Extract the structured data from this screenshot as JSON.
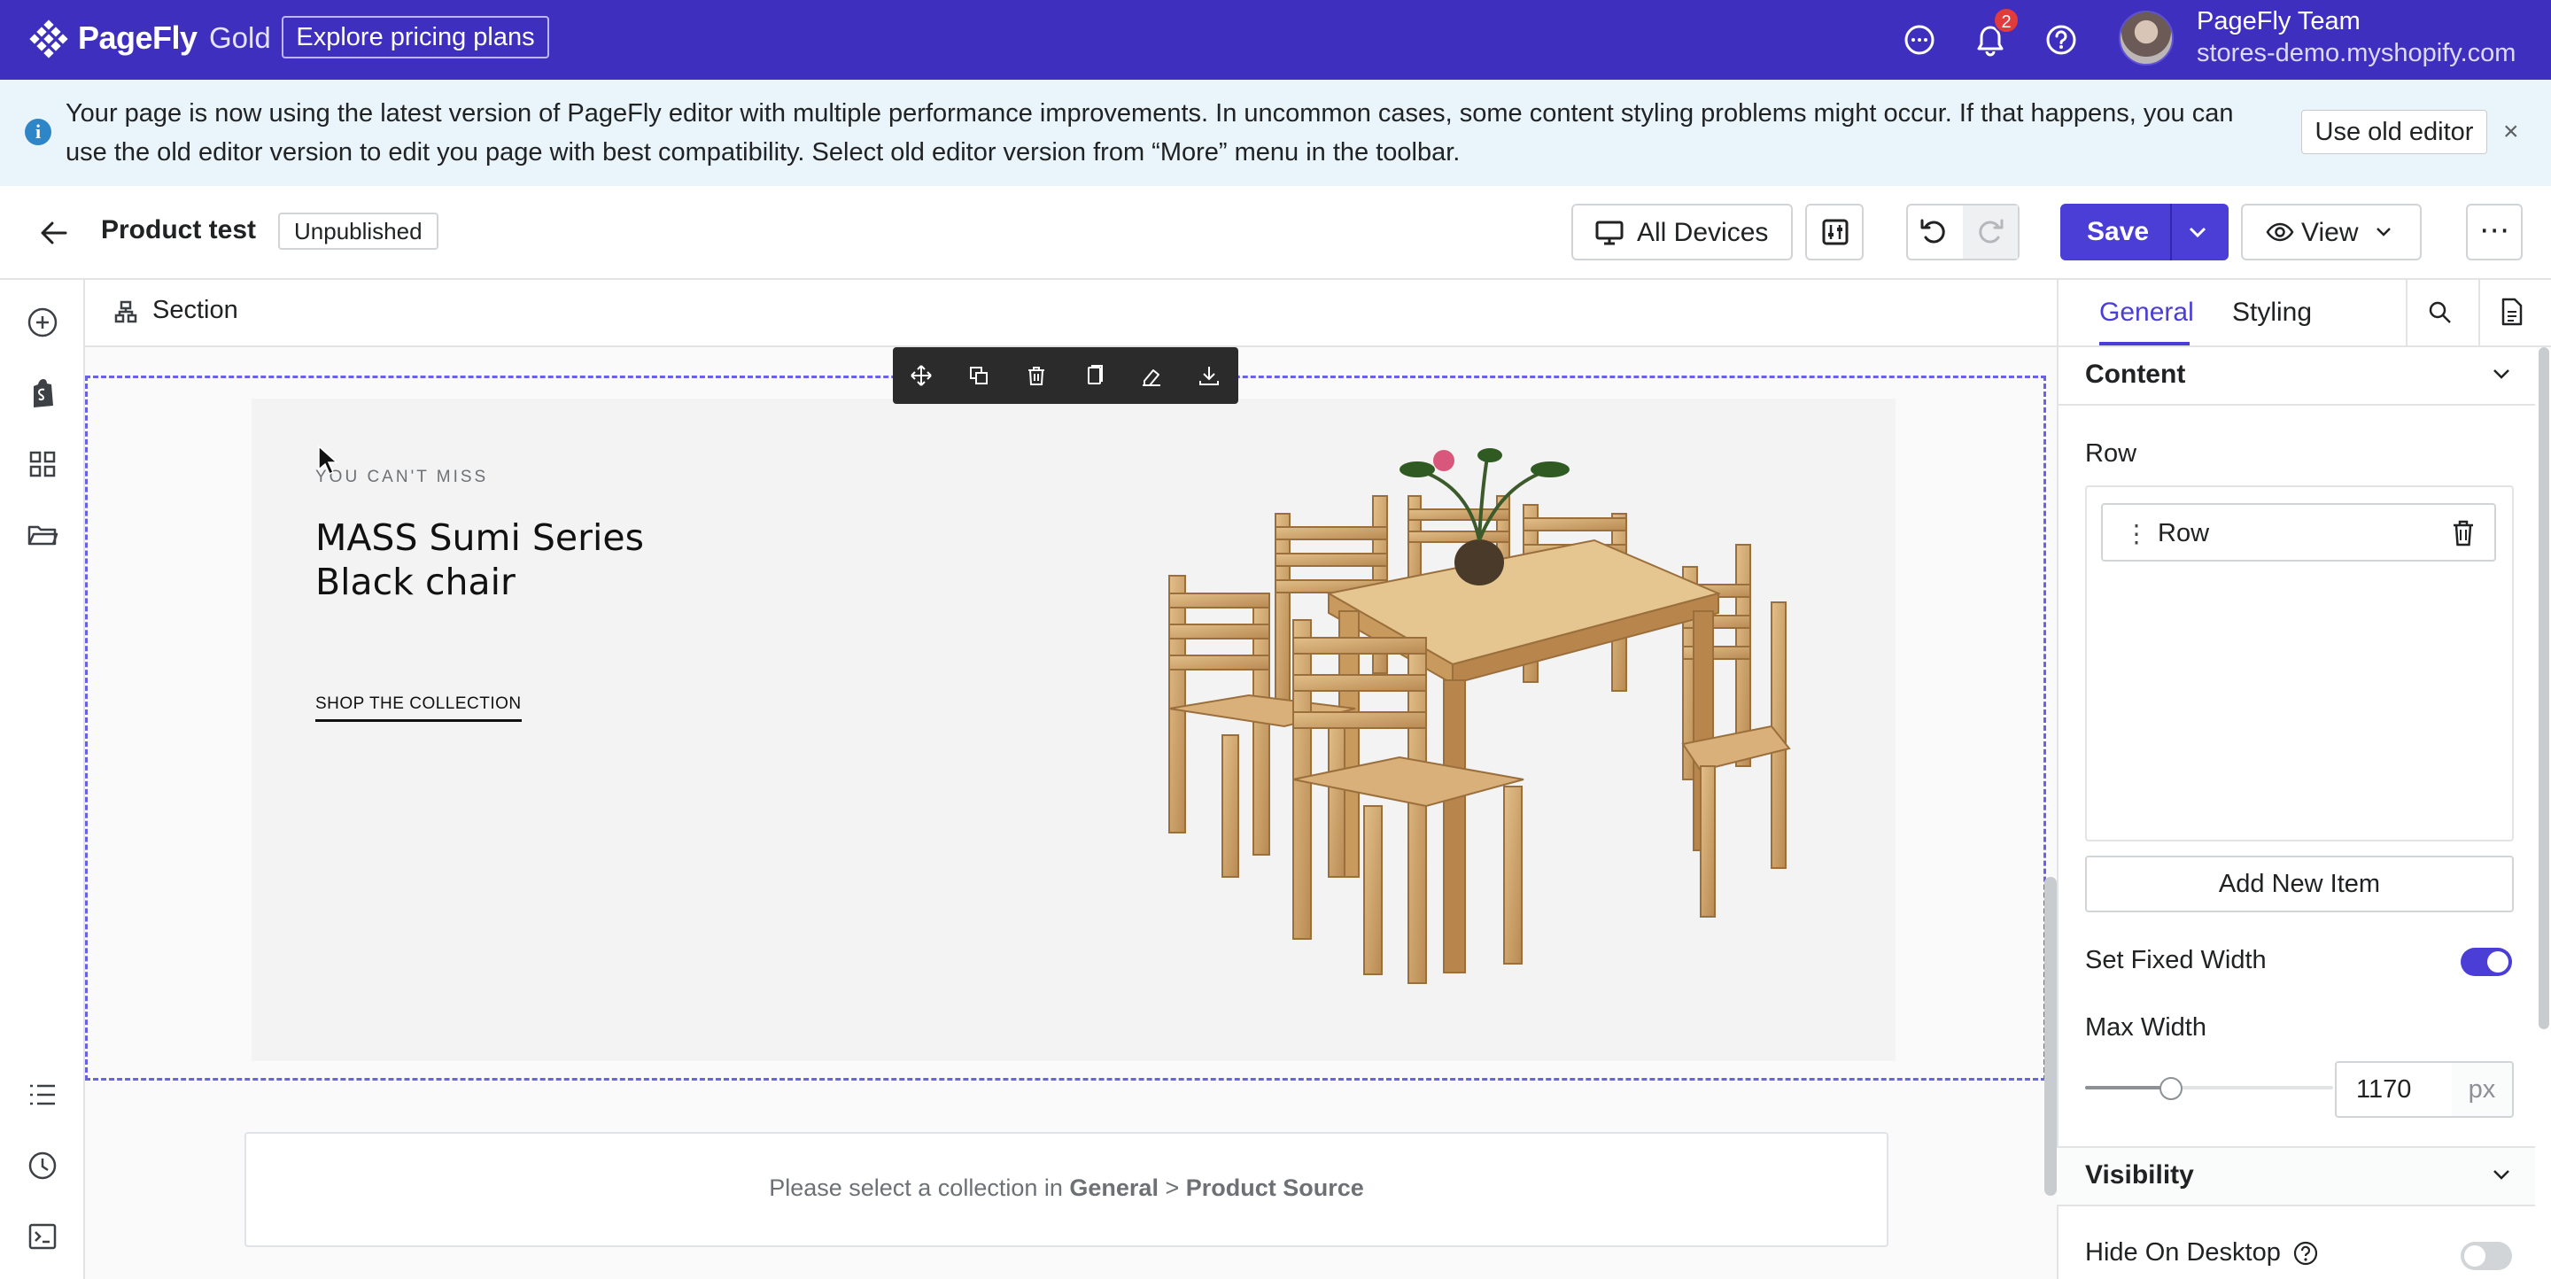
{
  "brand": {
    "name": "PageFly",
    "tier": "Gold",
    "pricing_label": "Explore pricing plans"
  },
  "topbar": {
    "notification_count": "2",
    "user_name": "PageFly Team",
    "user_store": "stores-demo.myshopify.com"
  },
  "banner": {
    "message": "Your page is now using the latest version of PageFly editor with multiple performance improvements. In uncommon cases, some content styling problems might occur. If that happens, you can use the old editor version to edit you page with best compatibility. Select old editor version from “More” menu in the toolbar.",
    "action_label": "Use old editor",
    "close_glyph": "×"
  },
  "editor_toolbar": {
    "page_name": "Product test",
    "status": "Unpublished",
    "devices_label": "All Devices",
    "save_label": "Save",
    "view_label": "View",
    "more_glyph": "⋯"
  },
  "canvas": {
    "breadcrumb": "Section",
    "hero": {
      "kicker": "YOU CAN'T MISS",
      "title_line1": "MASS Sumi Series",
      "title_line2": "Black chair",
      "cta": "SHOP THE COLLECTION"
    },
    "collection_notice": {
      "prefix": "Please select a collection in ",
      "part1": "General",
      "separator": " > ",
      "part2": "Product Source"
    }
  },
  "panel": {
    "tabs": [
      "General",
      "Styling"
    ],
    "active_tab": "General",
    "content_heading": "Content",
    "row_label": "Row",
    "row_items": [
      "Row"
    ],
    "add_item_label": "Add New Item",
    "fixed_width_label": "Set Fixed Width",
    "fixed_width_on": true,
    "max_width_label": "Max Width",
    "max_width_value": "1170",
    "max_width_unit": "px",
    "visibility_heading": "Visibility",
    "hide_desktop_label": "Hide On Desktop",
    "hide_desktop_on": false
  },
  "colors": {
    "topbar": "#3f2fbf",
    "accent": "#4a3ed6",
    "banner_bg": "#eaf4fb",
    "selection_outline": "#6a62e6"
  },
  "icons": {
    "topbar": [
      "chat-icon",
      "bell-icon",
      "help-icon"
    ],
    "left_rail": [
      "add-element-icon",
      "shopify-icon",
      "grid-icon",
      "folder-icon",
      "layers-list-icon",
      "history-clock-icon",
      "code-terminal-icon"
    ],
    "floating_toolbar": [
      "move-icon",
      "duplicate-icon",
      "delete-icon",
      "copy-icon",
      "paint-icon",
      "save-download-icon"
    ]
  }
}
